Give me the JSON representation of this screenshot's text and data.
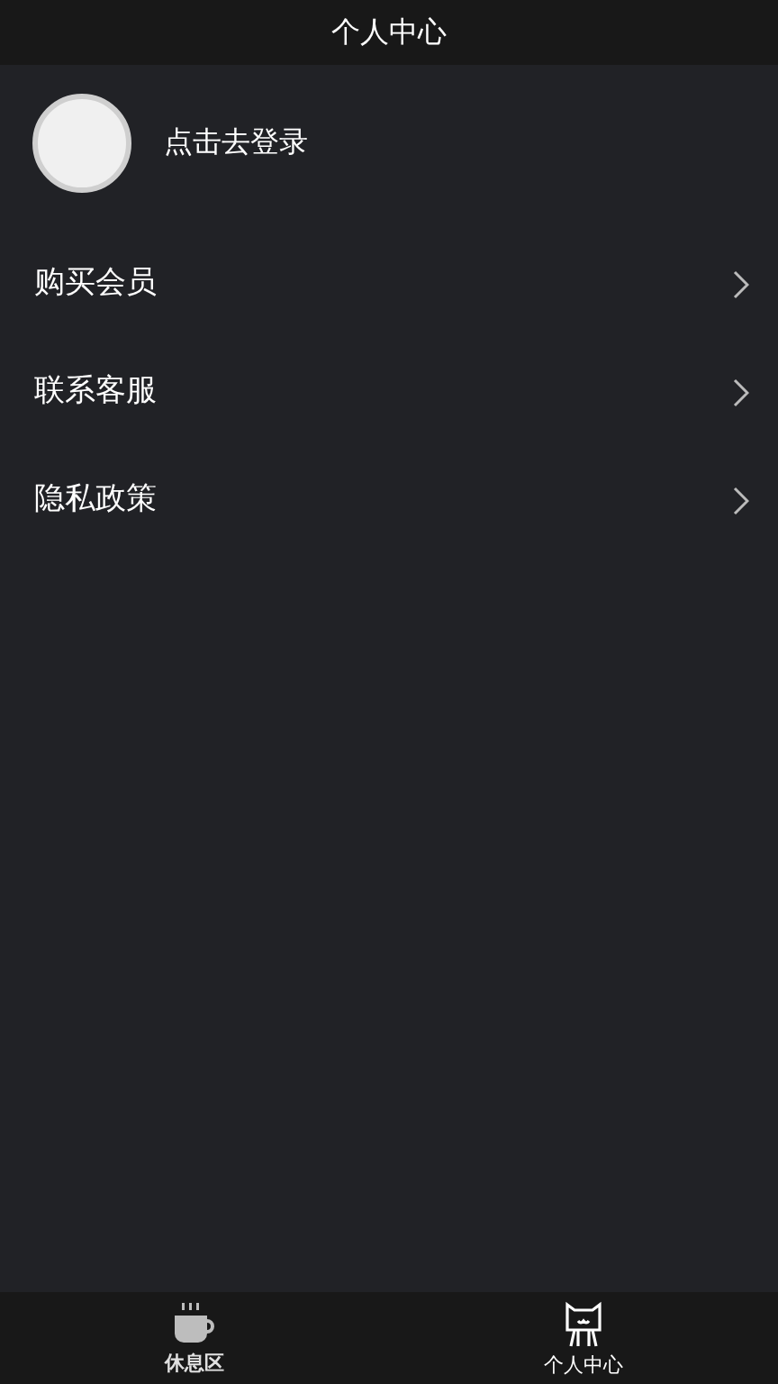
{
  "header": {
    "title": "个人中心"
  },
  "profile": {
    "login_text": "点击去登录"
  },
  "menu": [
    {
      "label": "购买会员"
    },
    {
      "label": "联系客服"
    },
    {
      "label": "隐私政策"
    }
  ],
  "tabs": [
    {
      "label": "休息区",
      "kind": "cup",
      "selected": false
    },
    {
      "label": "个人中心",
      "kind": "cat",
      "selected": true
    }
  ]
}
